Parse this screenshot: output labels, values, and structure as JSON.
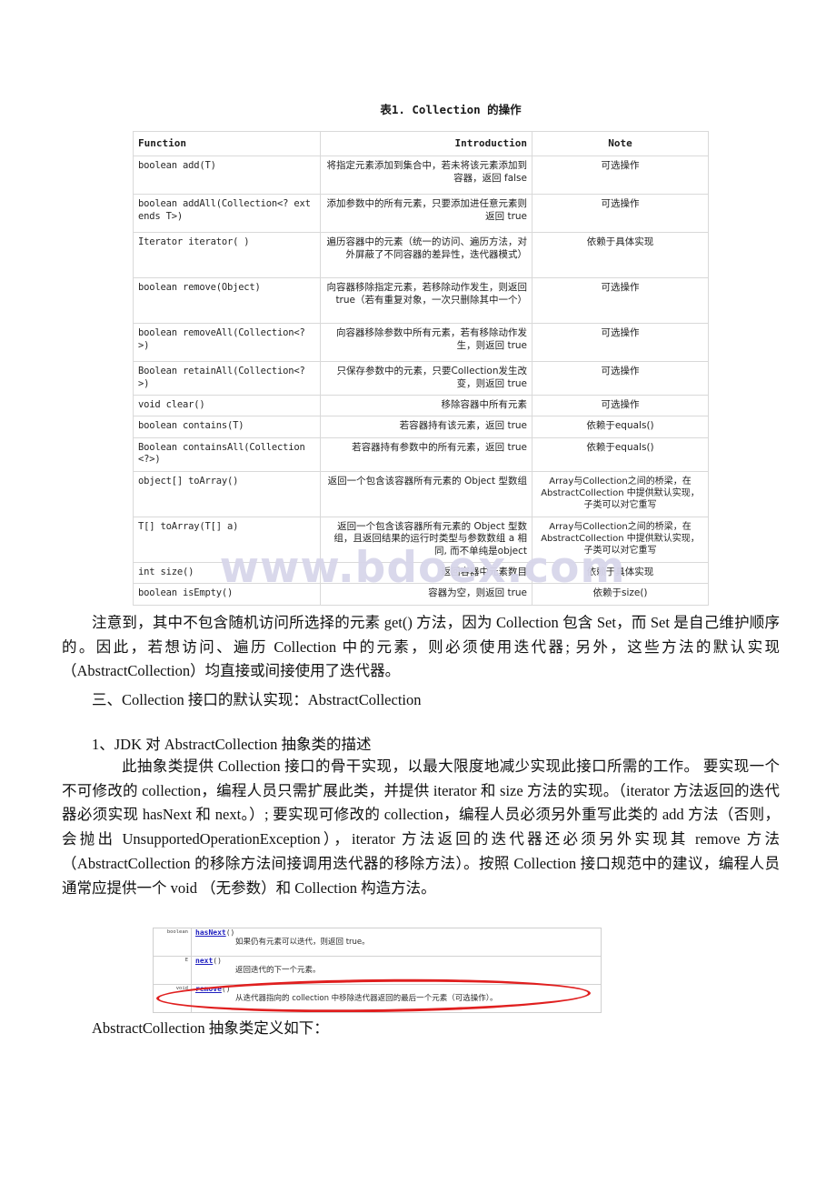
{
  "table": {
    "caption": "表1. Collection 的操作",
    "headers": {
      "function": "Function",
      "introduction": "Introduction",
      "note": "Note"
    },
    "rows": [
      {
        "function": "boolean add(T)",
        "introduction": "将指定元素添加到集合中，若未将该元素添加到容器，返回 false",
        "note": "可选操作"
      },
      {
        "function": "boolean addAll(Collection<? extends T>)",
        "introduction": "添加参数中的所有元素，只要添加进任意元素则返回 true",
        "note": "可选操作"
      },
      {
        "function": "Iterator iterator( )",
        "introduction": "遍历容器中的元素（统一的访问、遍历方法，对外屏蔽了不同容器的差异性，迭代器模式）",
        "note": "依赖于具体实现"
      },
      {
        "function": "boolean remove(Object)",
        "introduction": "向容器移除指定元素，若移除动作发生，则返回 true（若有重复对象，一次只删除其中一个）",
        "note": "可选操作"
      },
      {
        "function": "boolean removeAll(Collection<?>)",
        "introduction": "向容器移除参数中所有元素，若有移除动作发生，则返回 true",
        "note": "可选操作"
      },
      {
        "function": "Boolean retainAll(Collection<?>)",
        "introduction": "只保存参数中的元素，只要Collection发生改变，则返回 true",
        "note": "可选操作"
      },
      {
        "function": "void clear()",
        "introduction": "移除容器中所有元素",
        "note": "可选操作"
      },
      {
        "function": "boolean contains(T)",
        "introduction": "若容器持有该元素，返回 true",
        "note": "依赖于equals()"
      },
      {
        "function": "Boolean containsAll(Collection<?>)",
        "introduction": "若容器持有参数中的所有元素，返回 true",
        "note": "依赖于equals()"
      },
      {
        "function": "object[] toArray()",
        "introduction": "返回一个包含该容器所有元素的 Object 型数组",
        "note": "Array与Collection之间的桥梁，在 AbstractCollection 中提供默认实现，子类可以对它重写"
      },
      {
        "function": "T[] toArray(T[] a)",
        "introduction": "返回一个包含该容器所有元素的 Object 型数组，且返回结果的运行时类型与参数数组 a 相同, 而不单纯是object",
        "note": "Array与Collection之间的桥梁，在 AbstractCollection 中提供默认实现，子类可以对它重写"
      },
      {
        "function": "int size()",
        "introduction": "返回容器中元素数目",
        "note": "依赖于具体实现"
      },
      {
        "function": "boolean isEmpty()",
        "introduction": "容器为空，则返回 true",
        "note": "依赖于size()"
      }
    ]
  },
  "watermark": {
    "text": "www.bdoex.com",
    "color": "#d8d6ea"
  },
  "paragraphs": {
    "note": "注意到，其中不包含随机访问所选择的元素 get() 方法，因为 Collection 包含 Set，而 Set 是自己维护顺序的。因此，若想访问、遍历 Collection 中的元素，则必须使用迭代器; 另外，这些方法的默认实现（AbstractCollection）均直接或间接使用了迭代器。",
    "heading_three": "三、Collection 接口的默认实现：AbstractCollection",
    "heading_one": "1、JDK 对 AbstractCollection 抽象类的描述",
    "abstract_desc": "此抽象类提供 Collection 接口的骨干实现，以最大限度地减少实现此接口所需的工作。 要实现一个不可修改的 collection，编程人员只需扩展此类，并提供 iterator 和 size 方法的实现。（iterator 方法返回的迭代器必须实现 hasNext 和 next。）; 要实现可修改的 collection，编程人员必须另外重写此类的 add 方法（否则，会抛出 UnsupportedOperationException），iterator 方法返回的迭代器还必须另外实现其 remove 方法（AbstractCollection 的移除方法间接调用迭代器的移除方法）。按照 Collection 接口规范中的建议，编程人员通常应提供一个 void （无参数）和 Collection 构造方法。",
    "tail": "AbstractCollection 抽象类定义如下："
  },
  "javadoc_screenshot": {
    "rows": [
      {
        "return_type": "boolean",
        "method": "hasNext",
        "parens": "()",
        "description": "如果仍有元素可以迭代，则返回 true。",
        "code_token": "true"
      },
      {
        "return_type": "E",
        "method": "next",
        "parens": "()",
        "description": "返回迭代的下一个元素。",
        "code_token": ""
      },
      {
        "return_type": "void",
        "method": "remove",
        "parens": "()",
        "description": "从迭代器指向的 collection 中移除迭代器返回的最后一个元素（可选操作）。",
        "code_token": "collection"
      }
    ],
    "annotation": {
      "shape": "ellipse",
      "color": "#e01f1f",
      "targets_row": 3
    }
  }
}
